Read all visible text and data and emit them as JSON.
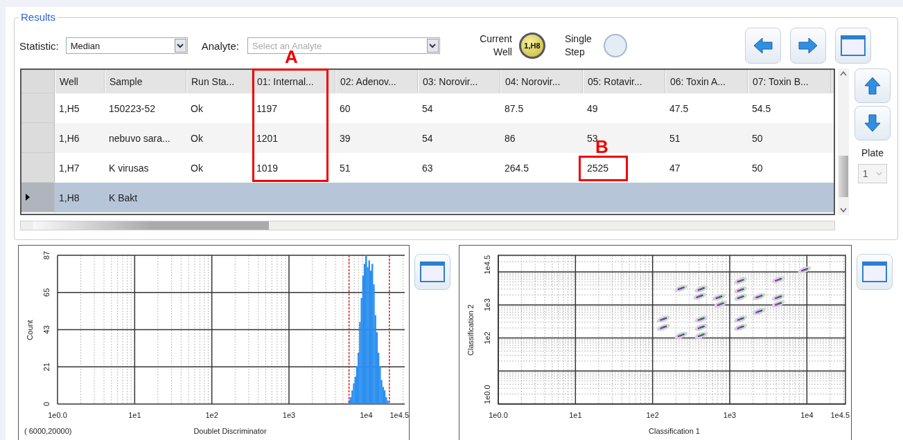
{
  "results": {
    "title": "Results",
    "statistic": {
      "label": "Statistic:",
      "value": "Median"
    },
    "analyte": {
      "label": "Analyte:",
      "placeholder": "Select an Analyte"
    },
    "current_well": {
      "label": "Current Well",
      "value": "1,H8"
    },
    "single_step": {
      "label": "Single Step",
      "on": false
    },
    "table": {
      "columns": [
        "Well",
        "Sample",
        "Run Sta...",
        "01: Internal...",
        "02: Adenov...",
        "03: Norovir...",
        "04: Norovir...",
        "05: Rotavir...",
        "06: Toxin A...",
        "07: Toxin B..."
      ],
      "rows": [
        {
          "selected": false,
          "cells": [
            "1,H5",
            "150223-52",
            "Ok",
            "1197",
            "60",
            "54",
            "87.5",
            "49",
            "47.5",
            "54.5"
          ]
        },
        {
          "selected": false,
          "cells": [
            "1,H6",
            "nebuvo sara...",
            "Ok",
            "1201",
            "39",
            "54",
            "86",
            "53",
            "51",
            "50"
          ]
        },
        {
          "selected": false,
          "cells": [
            "1,H7",
            "K virusas",
            "Ok",
            "1019",
            "51",
            "63",
            "264.5",
            "2525",
            "47",
            "50"
          ]
        },
        {
          "selected": true,
          "cells": [
            "1,H8",
            "K Bakt"
          ]
        }
      ]
    },
    "plate": {
      "label": "Plate",
      "value": "1",
      "disabled": true
    }
  },
  "annotations": [
    {
      "label": "A"
    },
    {
      "label": "B"
    }
  ],
  "histogram": {
    "x_axis_title": "Doublet Discriminator",
    "y_axis_title": "Count",
    "x_tick_labels": [
      "1e0.0",
      "1e1",
      "1e2",
      "1e3",
      "1e4",
      "1e4.5"
    ],
    "y_tick_labels": [
      "0",
      "21",
      "43",
      "65",
      "87"
    ],
    "gate_label": "( 6000,20000)"
  },
  "scatter": {
    "x_axis_title": "Classification 1",
    "y_axis_title": "Classification 2",
    "x_tick_labels": [
      "1e0.0",
      "1e1",
      "1e2",
      "1e3",
      "1e4",
      "1e4.5"
    ],
    "y_tick_labels": [
      "1e0.0",
      "1e2",
      "1e3",
      "1e4.5"
    ]
  }
}
